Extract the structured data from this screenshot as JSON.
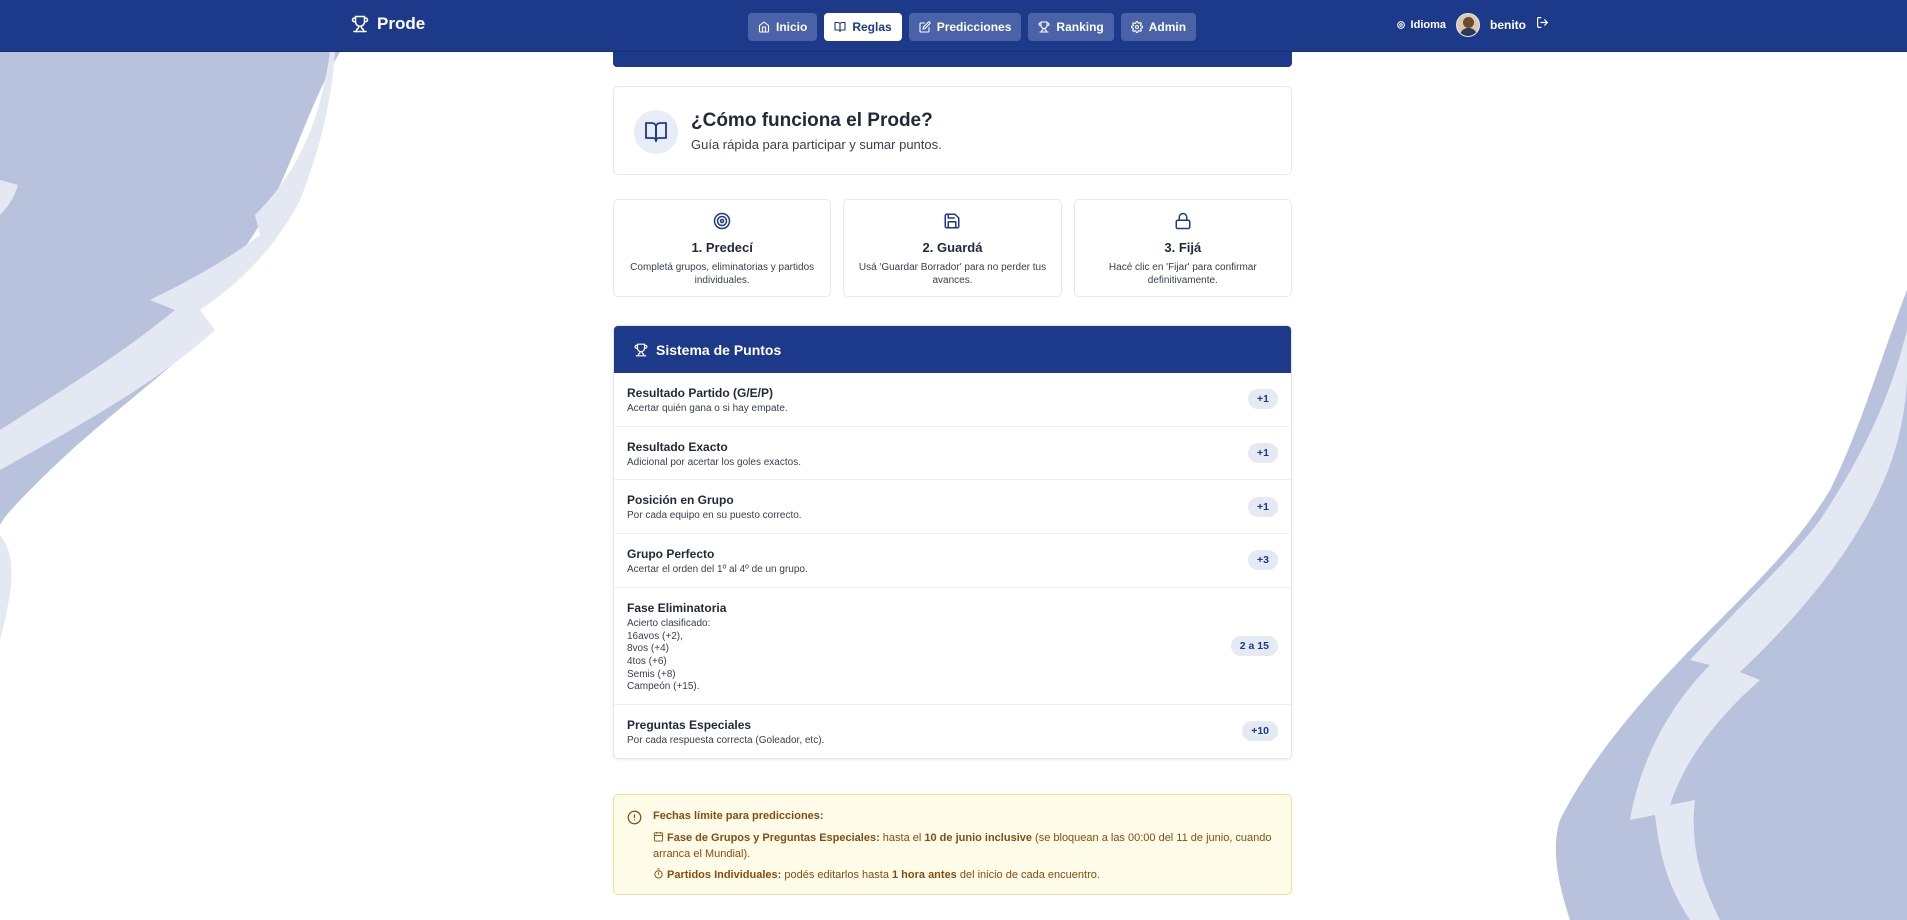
{
  "app": {
    "brand": "Prode"
  },
  "nav": {
    "items": [
      {
        "label": "Inicio",
        "icon": "home-icon"
      },
      {
        "label": "Reglas",
        "icon": "book-icon",
        "active": true
      },
      {
        "label": "Predicciones",
        "icon": "edit-icon"
      },
      {
        "label": "Ranking",
        "icon": "trophy-icon"
      },
      {
        "label": "Admin",
        "icon": "gear-icon"
      }
    ],
    "language_label": "Idioma",
    "username": "benito"
  },
  "intro": {
    "title": "¿Cómo funciona el Prode?",
    "subtitle": "Guía rápida para participar y sumar puntos."
  },
  "steps": [
    {
      "icon": "target-icon",
      "title": "1. Predecí",
      "desc": "Completá grupos, eliminatorias y partidos individuales."
    },
    {
      "icon": "save-icon",
      "title": "2. Guardá",
      "desc": "Usá 'Guardar Borrador' para no perder tus avances."
    },
    {
      "icon": "lock-icon",
      "title": "3. Fijá",
      "desc": "Hacé clic en 'Fijar' para confirmar definitivamente."
    }
  ],
  "points": {
    "title": "Sistema de Puntos",
    "rows": [
      {
        "name": "Resultado Partido (G/E/P)",
        "desc": [
          "Acertar quién gana o si hay empate."
        ],
        "badge": "+1"
      },
      {
        "name": "Resultado Exacto",
        "desc": [
          "Adicional por acertar los goles exactos."
        ],
        "badge": "+1"
      },
      {
        "name": "Posición en Grupo",
        "desc": [
          "Por cada equipo en su puesto correcto."
        ],
        "badge": "+1"
      },
      {
        "name": "Grupo Perfecto",
        "desc": [
          "Acertar el orden del 1º al 4º de un grupo."
        ],
        "badge": "+3"
      },
      {
        "name": "Fase Eliminatoria",
        "desc": [
          "Acierto clasificado:",
          "16avos (+2),",
          "8vos (+4)",
          "4tos (+6)",
          "Semis (+8)",
          "Campeón (+15)."
        ],
        "badge": "2 a 15"
      },
      {
        "name": "Preguntas Especiales",
        "desc": [
          "Por cada respuesta correcta (Goleador, etc)."
        ],
        "badge": "+10"
      }
    ]
  },
  "deadlines": {
    "title": "Fechas límite para predicciones:",
    "line1": {
      "label": "Fase de Grupos y Preguntas Especiales:",
      "pre": " hasta el ",
      "strong": "10 de junio inclusive",
      "post": " (se bloquean a las 00:00 del 11 de junio, cuando arranca el Mundial)."
    },
    "line2": {
      "label": "Partidos Individuales:",
      "pre": " podés editarlos hasta ",
      "strong": "1 hora antes",
      "post": " del inicio de cada encuentro."
    }
  },
  "colors": {
    "primary": "#1d3a8a",
    "nav_item": "#4a63a8",
    "art_dark": "#b8c2dd",
    "art_light": "#e3e8f3",
    "warning_bg": "#fefce8",
    "warning_text": "#854d0e"
  }
}
